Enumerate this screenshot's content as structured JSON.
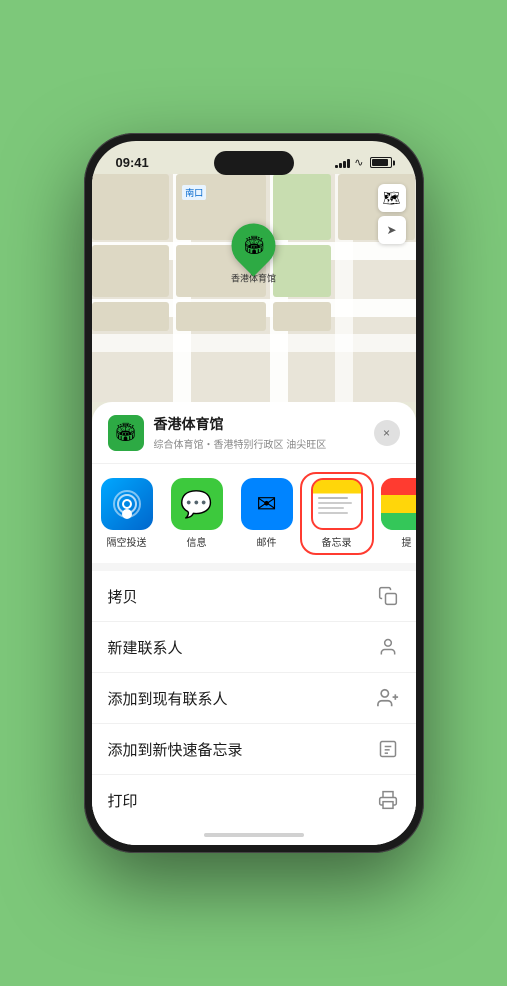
{
  "phone": {
    "status_bar": {
      "time": "09:41",
      "location_indicator": "▶"
    }
  },
  "map": {
    "label": "南口",
    "controls": {
      "map_type": "🗺",
      "location": "➤"
    }
  },
  "pin": {
    "label": "香港体育馆"
  },
  "bottom_sheet": {
    "venue_name": "香港体育馆",
    "venue_desc": "综合体育馆・香港特别行政区 油尖旺区",
    "close_label": "×"
  },
  "share_apps": [
    {
      "id": "airdrop",
      "label": "隔空投送",
      "selected": false
    },
    {
      "id": "messages",
      "label": "信息",
      "selected": false
    },
    {
      "id": "mail",
      "label": "邮件",
      "selected": false
    },
    {
      "id": "notes",
      "label": "备忘录",
      "selected": true
    },
    {
      "id": "more",
      "label": "提",
      "selected": false
    }
  ],
  "actions": [
    {
      "id": "copy",
      "label": "拷贝",
      "icon": "copy"
    },
    {
      "id": "new-contact",
      "label": "新建联系人",
      "icon": "person"
    },
    {
      "id": "add-existing",
      "label": "添加到现有联系人",
      "icon": "person-add"
    },
    {
      "id": "quick-note",
      "label": "添加到新快速备忘录",
      "icon": "note"
    },
    {
      "id": "print",
      "label": "打印",
      "icon": "printer"
    }
  ]
}
